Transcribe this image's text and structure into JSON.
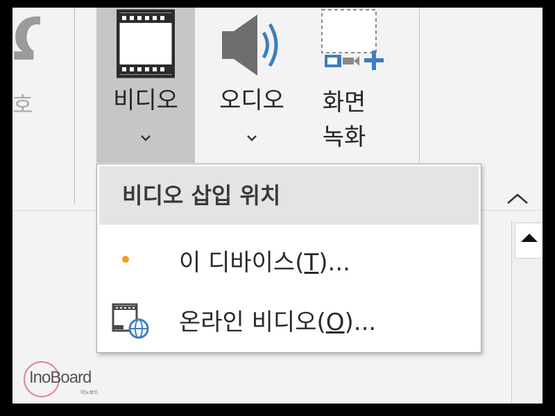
{
  "ribbon": {
    "prev_label": "호",
    "video": {
      "label": "비디오",
      "icon": "film-icon"
    },
    "audio": {
      "label": "오디오",
      "icon": "speaker-icon"
    },
    "screen_record": {
      "label": "화면 녹화",
      "icon": "screen-recording-icon"
    }
  },
  "video_menu": {
    "header": "비디오 삽입 위치",
    "items": [
      {
        "label": "이 디바이스(",
        "accelerator": "T",
        "suffix": ")...",
        "icon": "dot-icon"
      },
      {
        "label": "온라인 비디오(",
        "accelerator": "O",
        "suffix": ")...",
        "icon": "online-video-icon"
      }
    ]
  },
  "watermark": {
    "brand": "InoBoard",
    "sub": "이노보드"
  },
  "colors": {
    "ribbon_bg": "#f3f3f3",
    "selected_button_bg": "#c6c6c6",
    "menu_header_bg": "#e4e4e4",
    "accent_blue": "#3e7dc0",
    "dot_orange": "#f59a23"
  }
}
